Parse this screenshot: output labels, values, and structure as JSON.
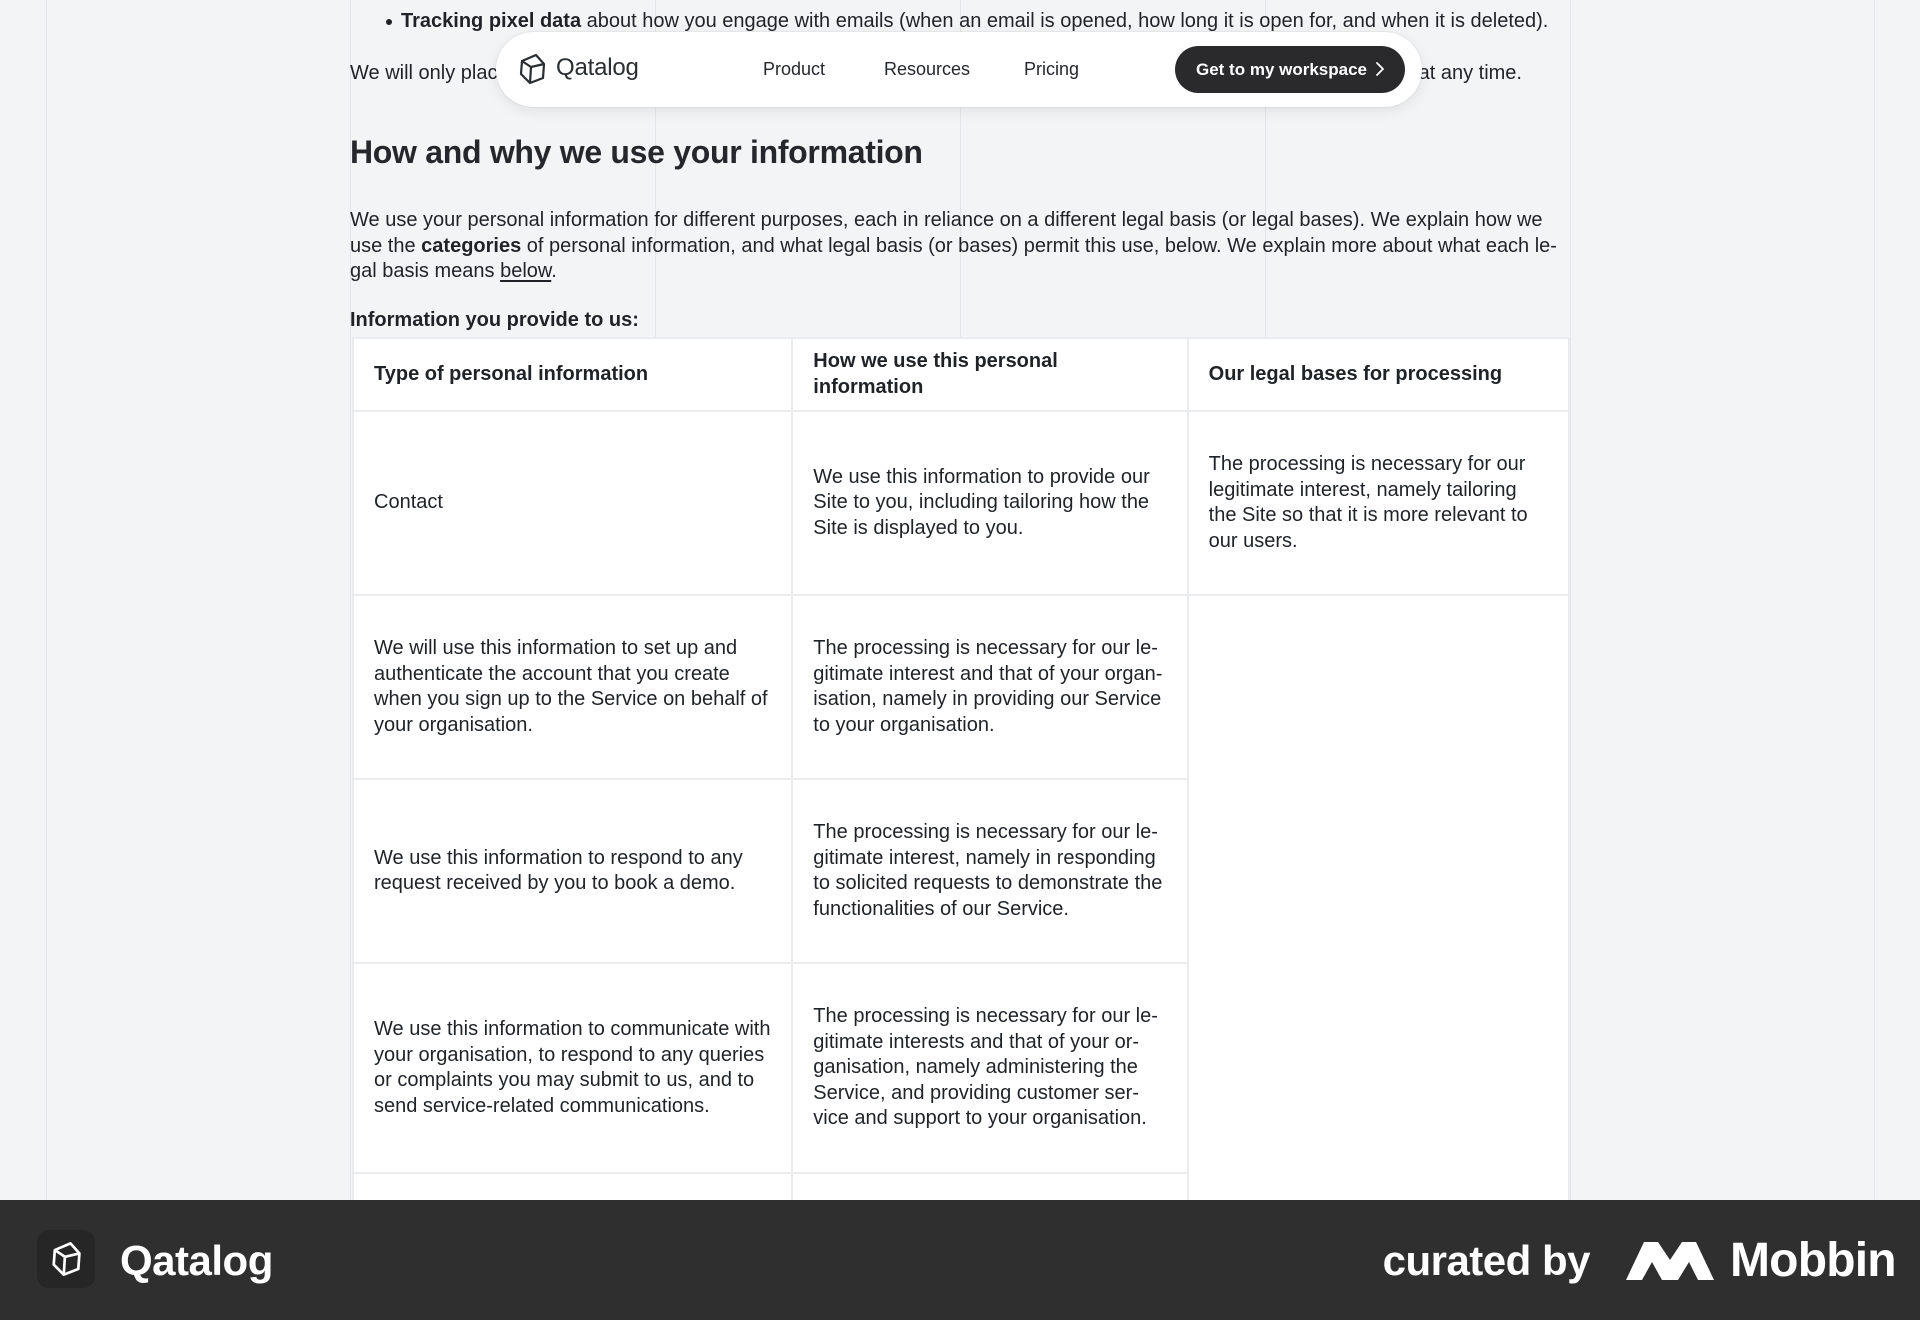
{
  "doc": {
    "bullet_bold": "Tracking pixel data",
    "bullet_rest": " about how you engage with emails (when an email is opened, how long it is open for, and when it is deleted).",
    "only_place_start": "We will only plac",
    "only_place_end": "at any time.",
    "heading": "How and why we use your information",
    "intro_a": "We use your personal information for different purposes, each in reliance on a different legal basis (or legal bases). We explain how we use the ",
    "intro_bold": "categories",
    "intro_b": " of personal information, and what legal basis (or bases) permit this use, below. We explain more about what each le-gal basis means ",
    "intro_link": "below",
    "intro_c": ".",
    "subhead": "Information you provide to us:"
  },
  "table": {
    "headers": [
      "Type of personal information",
      "How we use this personal information",
      "Our legal bases for processing"
    ],
    "rows": [
      [
        "Contact",
        "We use this information to provide our Site to you, including tailoring how the Site is displayed to you.",
        "The processing is necessary for our legitimate interest, namely tailoring the Site so that it is more relevant to our users."
      ],
      [
        "We will use this information to set up and authenticate the account that you create when you sign up to the Service on behalf of your organisation.",
        "The processing is necessary for our le-gitimate interest and that of your organ-isation, namely in providing our Service to your organisation.",
        ""
      ],
      [
        "We use this information to respond to any request received by you to book a demo.",
        "The processing is necessary for our le-gitimate interest, namely in responding to solicited requests to demonstrate the functionalities of our Service.",
        ""
      ],
      [
        "We use this information to communicate with your organisation, to respond to any queries or complaints you may submit to us, and to send service-related communications.",
        "The processing is necessary for our le-gitimate interests and that of your or-ganisation, namely administering the Service, and providing customer ser-vice and support to your organisation.",
        ""
      ]
    ]
  },
  "nav": {
    "brand": "Qatalog",
    "links": [
      "Product",
      "Resources",
      "Pricing"
    ],
    "cta": "Get to my workspace",
    "logo_icon": "qatalog-logo-icon",
    "cta_icon": "chevron-right-icon"
  },
  "footer": {
    "brand": "Qatalog",
    "curated": "curated by",
    "mobbin": "Mobbin",
    "bg": "#2f2f2f"
  }
}
